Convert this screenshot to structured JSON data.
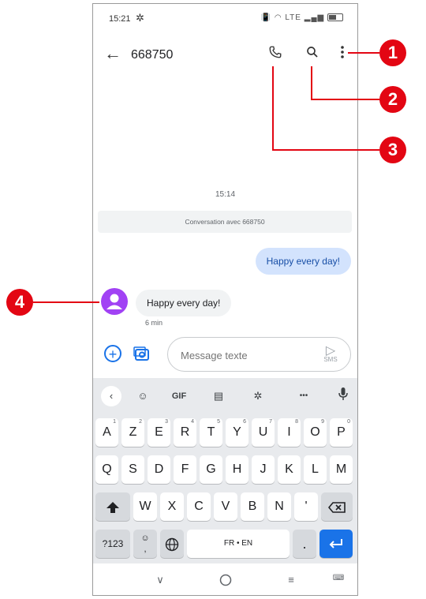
{
  "status_bar": {
    "time": "15:21",
    "network": "LTE"
  },
  "app_bar": {
    "title": "668750"
  },
  "conversation": {
    "timestamp": "15:14",
    "info": "Conversation avec 668750",
    "outgoing_message": "Happy every day!",
    "incoming_message": "Happy every day!",
    "incoming_time": "6 min"
  },
  "compose": {
    "placeholder": "Message texte",
    "send_label": "SMS"
  },
  "keyboard": {
    "toolbar": {
      "gif_label": "GIF",
      "more_label": "•••"
    },
    "row1": [
      {
        "key": "A",
        "alt": "1"
      },
      {
        "key": "Z",
        "alt": "2"
      },
      {
        "key": "E",
        "alt": "3"
      },
      {
        "key": "R",
        "alt": "4"
      },
      {
        "key": "T",
        "alt": "5"
      },
      {
        "key": "Y",
        "alt": "6"
      },
      {
        "key": "U",
        "alt": "7"
      },
      {
        "key": "I",
        "alt": "8"
      },
      {
        "key": "O",
        "alt": "9"
      },
      {
        "key": "P",
        "alt": "0"
      }
    ],
    "row2": [
      "Q",
      "S",
      "D",
      "F",
      "G",
      "H",
      "J",
      "K",
      "L",
      "M"
    ],
    "row3": [
      "W",
      "X",
      "C",
      "V",
      "B",
      "N",
      "'"
    ],
    "symbols_label": "?123",
    "space_label": "FR • EN",
    "period_label": ".",
    "comma_label": ","
  },
  "callouts": [
    "1",
    "2",
    "3",
    "4"
  ],
  "colors": {
    "accent": "#1a73e8",
    "callout": "#e30613",
    "avatar": "#a142f4",
    "outgoing_bubble": "#d3e3fd"
  }
}
